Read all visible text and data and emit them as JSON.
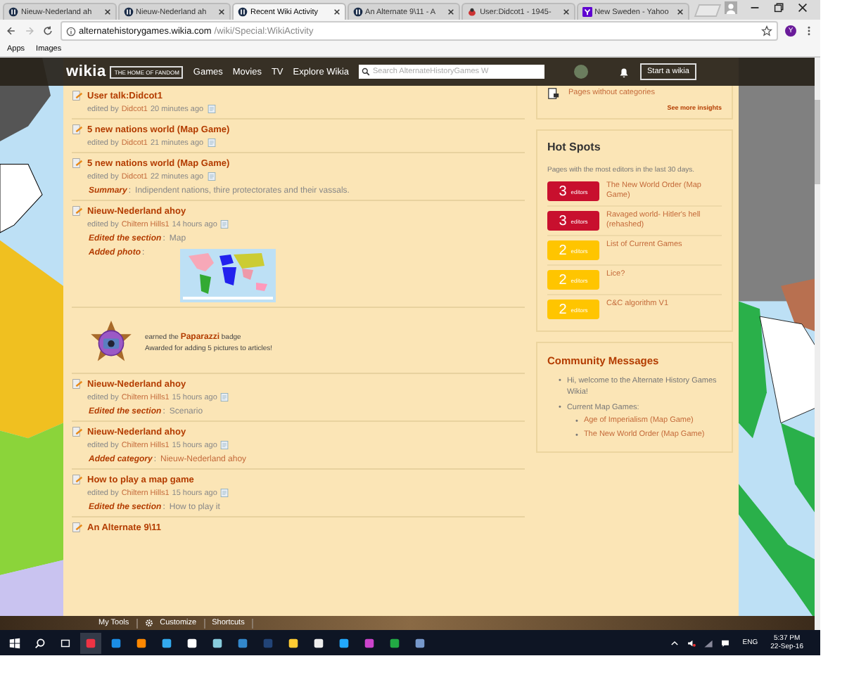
{
  "browser": {
    "tabs": [
      {
        "title": "Nieuw-Nederland ah",
        "selected": false,
        "kind": "wikia"
      },
      {
        "title": "Nieuw-Nederland ah",
        "selected": false,
        "kind": "wikia"
      },
      {
        "title": "Recent Wiki Activity",
        "selected": true,
        "kind": "wikia"
      },
      {
        "title": "An Alternate 9\\11 - A",
        "selected": false,
        "kind": "wikia"
      },
      {
        "title": "User:Didcot1 - 1945-",
        "selected": false,
        "kind": "bug"
      },
      {
        "title": "New Sweden - Yahoo",
        "selected": false,
        "kind": "yahoo"
      }
    ],
    "address": {
      "domain": "alternatehistorygames.wikia.com",
      "path": "/wiki/Special:WikiActivity"
    },
    "profile": "Y",
    "bookmarks": [
      "Apps",
      "Images"
    ]
  },
  "header": {
    "logo": "wikia",
    "tagline": "THE HOME OF FANDOM",
    "nav": [
      "Games",
      "Movies",
      "TV",
      "Explore Wikia"
    ],
    "search_placeholder": "Search AlternateHistoryGames W",
    "start_button": "Start a wikia"
  },
  "feed": [
    {
      "kind": "edit",
      "title": "User talk:Didcot1",
      "by": "edited by",
      "user": "Didcot1",
      "time": "20 minutes ago"
    },
    {
      "kind": "edit",
      "title": "5 new nations world (Map Game)",
      "by": "edited by",
      "user": "Didcot1",
      "time": "21 minutes ago"
    },
    {
      "kind": "edit",
      "title": "5 new nations world (Map Game)",
      "by": "edited by",
      "user": "Didcot1",
      "time": "22 minutes ago",
      "details": [
        {
          "kind": "text",
          "label": "Summary",
          "sep": ":",
          "text": "Indipendent nations, thire protectorates and their vassals."
        }
      ]
    },
    {
      "kind": "edit",
      "title": "Nieuw-Nederland ahoy",
      "by": "edited by",
      "user": "Chiltern Hills1",
      "time": "14 hours ago",
      "details": [
        {
          "kind": "text",
          "label": "Edited the section",
          "sep": ":",
          "text": "Map"
        },
        {
          "kind": "photo",
          "label": "Added photo",
          "sep": ":"
        }
      ]
    },
    {
      "kind": "badge",
      "prefix": "earned the",
      "badge": "Paparazzi",
      "suffix": "badge",
      "note": "Awarded for adding 5 pictures to articles!"
    },
    {
      "kind": "edit",
      "title": "Nieuw-Nederland ahoy",
      "by": "edited by",
      "user": "Chiltern Hills1",
      "time": "15 hours ago",
      "details": [
        {
          "kind": "text",
          "label": "Edited the section",
          "sep": ":",
          "text": "Scenario"
        }
      ]
    },
    {
      "kind": "edit",
      "title": "Nieuw-Nederland ahoy",
      "by": "edited by",
      "user": "Chiltern Hills1",
      "time": "15 hours ago",
      "details": [
        {
          "kind": "link",
          "label": "Added category",
          "sep": ":",
          "text": "Nieuw-Nederland ahoy"
        }
      ]
    },
    {
      "kind": "edit",
      "title": "How to play a map game",
      "by": "edited by",
      "user": "Chiltern Hills1",
      "time": "15 hours ago",
      "details": [
        {
          "kind": "text",
          "label": "Edited the section",
          "sep": ":",
          "text": "How to play it"
        }
      ]
    },
    {
      "kind": "edit",
      "title": "An Alternate 9\\11"
    }
  ],
  "insights": {
    "link": "Pages without categories",
    "more": "See more insights"
  },
  "hot_spots": {
    "title": "Hot Spots",
    "intro": "Pages with the most editors in the last 30 days.",
    "items": [
      {
        "count": "3",
        "unit": "editors",
        "title": "The New World Order (Map Game)",
        "color": "#c8102e"
      },
      {
        "count": "3",
        "unit": "editors",
        "title": "Ravaged world- Hitler's hell (rehashed)",
        "color": "#c8102e"
      },
      {
        "count": "2",
        "unit": "editors",
        "title": "List of Current Games",
        "color": "#ffc500"
      },
      {
        "count": "2",
        "unit": "editors",
        "title": "Lice?",
        "color": "#ffc500"
      },
      {
        "count": "2",
        "unit": "editors",
        "title": "C&C algorithm V1",
        "color": "#ffc500"
      }
    ]
  },
  "community": {
    "title": "Community Messages",
    "items": [
      {
        "marker": "•",
        "text": "Hi, welcome to the Alternate History Games Wikia!"
      },
      {
        "marker": "•",
        "text": "Current Map Games:",
        "children": [
          {
            "marker": "•",
            "text": "Age of Imperialism (Map Game)"
          },
          {
            "marker": "•",
            "text": "The New World Order (Map Game)"
          }
        ]
      }
    ]
  },
  "toolbar": [
    "My Tools",
    "Customize",
    "Shortcuts"
  ],
  "taskbar": {
    "language": "ENG",
    "time": "5:37 PM",
    "date": "22-Sep-16"
  }
}
